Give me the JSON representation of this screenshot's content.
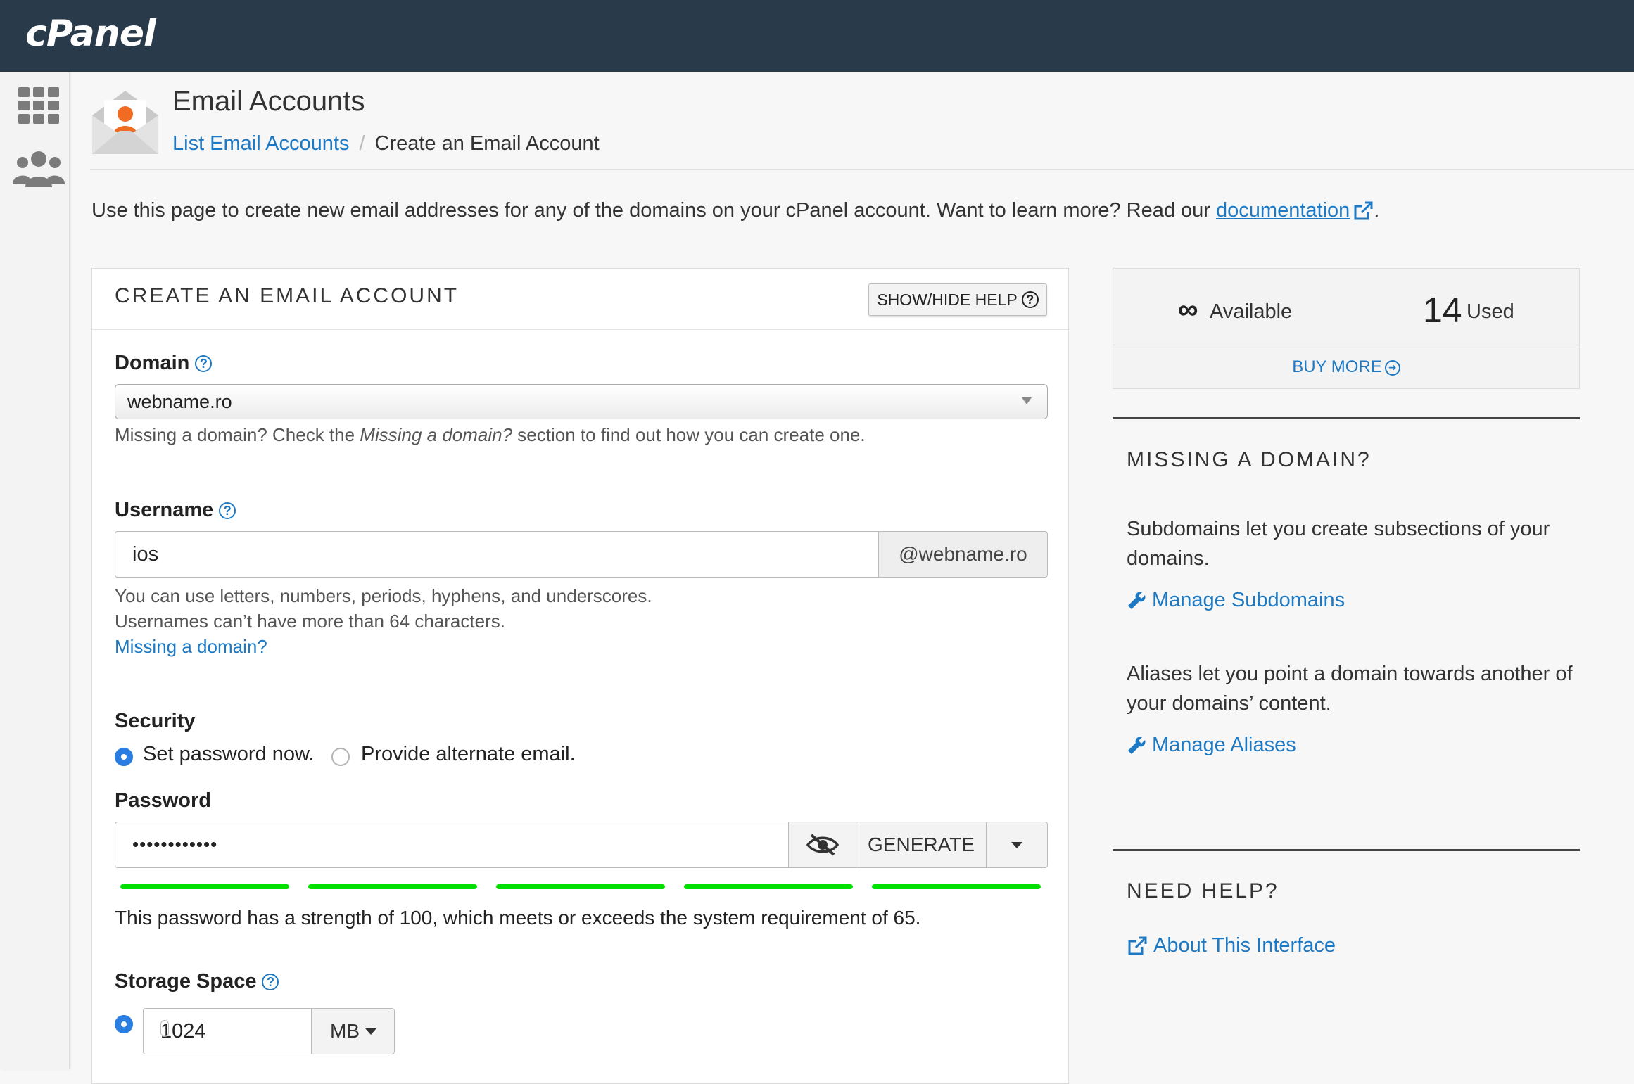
{
  "app": {
    "logo": "cPanel"
  },
  "header": {
    "title": "Email Accounts",
    "breadcrumb": {
      "link": "List Email Accounts",
      "separator": "/",
      "current": "Create an Email Account"
    }
  },
  "intro": {
    "text": "Use this page to create new email addresses for any of the domains on your cPanel account. Want to learn more? Read our ",
    "link": "documentation",
    "end": "."
  },
  "form": {
    "title": "CREATE AN EMAIL ACCOUNT",
    "help_button": "SHOW/HIDE HELP",
    "domain_label": "Domain",
    "domain_value": "webname.ro",
    "domain_hint_a": "Missing a domain? Check the ",
    "domain_hint_em": "Missing a domain?",
    "domain_hint_b": " section to find out how you can create one.",
    "username_label": "Username",
    "username_value": "ios",
    "username_suffix": "@webname.ro",
    "username_hint1": "You can use letters, numbers, periods, hyphens, and underscores.",
    "username_hint2": "Usernames can’t have more than 64 characters.",
    "missing_link": "Missing a domain?",
    "security_label": "Security",
    "security_opt1": "Set password now.",
    "security_opt2": "Provide alternate email.",
    "password_label": "Password",
    "password_value": "••••••••••••",
    "generate_label": "GENERATE",
    "strength_text": "This password has a strength of 100, which meets or exceeds the system requirement of 65.",
    "strength_value": 100,
    "storage_label": "Storage Space",
    "storage_value": "1024",
    "storage_unit": "MB"
  },
  "stats": {
    "available_symbol": "∞",
    "available_label": "Available",
    "used_value": "14",
    "used_label": "Used",
    "buy_more": "BUY MORE"
  },
  "missing_domain": {
    "title": "MISSING A DOMAIN?",
    "text1": "Subdomains let you create subsections of your domains.",
    "link1": "Manage Subdomains",
    "text2": "Aliases let you point a domain towards another of your domains’ content.",
    "link2": "Manage Aliases"
  },
  "need_help": {
    "title": "NEED HELP?",
    "link": "About This Interface"
  },
  "colors": {
    "topbar": "#293a4a",
    "link": "#1d79c4",
    "strength": "#00e000",
    "radio": "#2a7de1"
  }
}
